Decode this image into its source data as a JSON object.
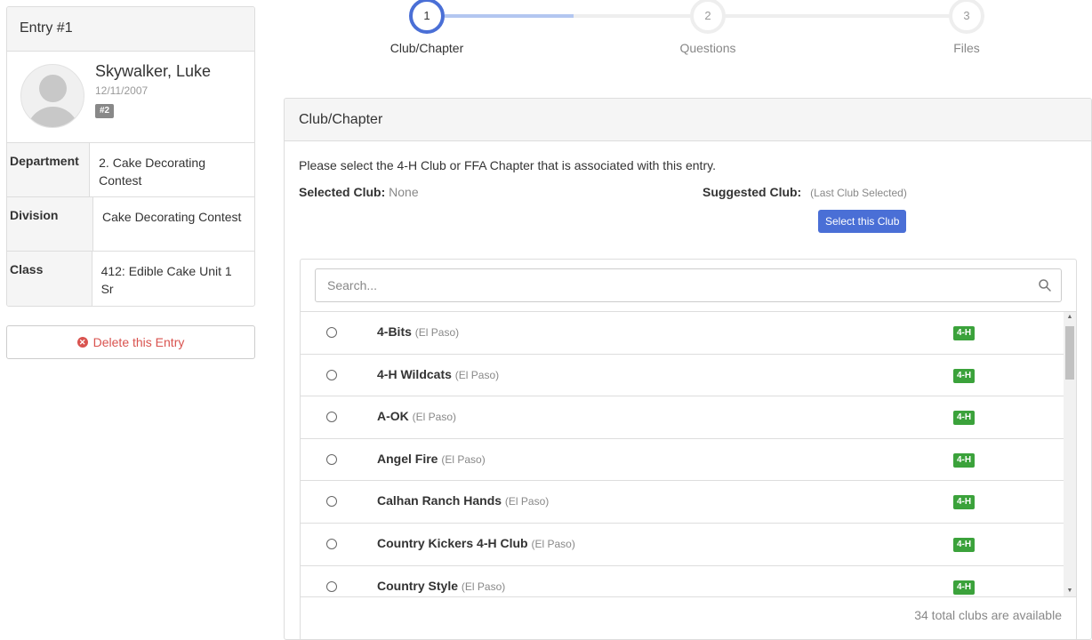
{
  "entry": {
    "title": "Entry #1",
    "name": "Skywalker, Luke",
    "dob": "12/11/2007",
    "badge": "#2",
    "details": [
      {
        "label": "Department",
        "value": "2. Cake Decorating Contest"
      },
      {
        "label": "Division",
        "value": "Cake Decorating Contest"
      },
      {
        "label": "Class",
        "value": "412: Edible Cake Unit 1 Sr"
      }
    ],
    "delete_label": "Delete this Entry"
  },
  "stepper": {
    "steps": [
      {
        "number": "1",
        "label": "Club/Chapter",
        "active": true
      },
      {
        "number": "2",
        "label": "Questions",
        "active": false
      },
      {
        "number": "3",
        "label": "Files",
        "active": false
      }
    ]
  },
  "club_panel": {
    "title": "Club/Chapter",
    "instructions": "Please select the 4-H Club or FFA Chapter that is associated with this entry.",
    "selected_label": "Selected Club:",
    "selected_value": "None",
    "suggested_label": "Suggested Club:",
    "suggested_hint": "(Last Club Selected)",
    "select_button": "Select this Club",
    "search_placeholder": "Search...",
    "clubs": [
      {
        "name": "4-Bits",
        "county": "(El Paso)",
        "tag": "4-H"
      },
      {
        "name": "4-H Wildcats",
        "county": "(El Paso)",
        "tag": "4-H"
      },
      {
        "name": "A-OK",
        "county": "(El Paso)",
        "tag": "4-H"
      },
      {
        "name": "Angel Fire",
        "county": "(El Paso)",
        "tag": "4-H"
      },
      {
        "name": "Calhan Ranch Hands",
        "county": "(El Paso)",
        "tag": "4-H"
      },
      {
        "name": "Country Kickers 4-H Club",
        "county": "(El Paso)",
        "tag": "4-H"
      },
      {
        "name": "Country Style",
        "county": "(El Paso)",
        "tag": "4-H"
      }
    ],
    "total_text": "34 total clubs are available"
  },
  "colors": {
    "primary": "#4a6fd6",
    "danger": "#d9534f",
    "tag_green": "#3ba23b",
    "badge_gray": "#888888"
  }
}
